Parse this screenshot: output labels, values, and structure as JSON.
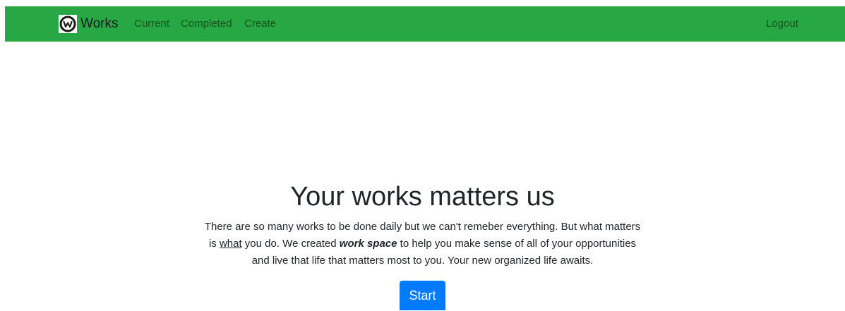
{
  "navbar": {
    "brand": {
      "logo_icon": "workplace-logo-icon",
      "label": "Works"
    },
    "links": {
      "current": "Current",
      "completed": "Completed",
      "create": "Create",
      "logout": "Logout"
    },
    "background_color": "#28a745"
  },
  "hero": {
    "title": "Your works matters us",
    "text_part1": "There are so many works to be done daily but we can't remeber everything. But what matters is ",
    "text_underlined": "what",
    "text_part2": " you do. We created ",
    "text_bold": "work space",
    "text_part3": " to help you make sense of all of your opportunities and live that life that matters most to you. Your new organized life awaits.",
    "start_button": "Start",
    "button_color": "#007bff"
  }
}
